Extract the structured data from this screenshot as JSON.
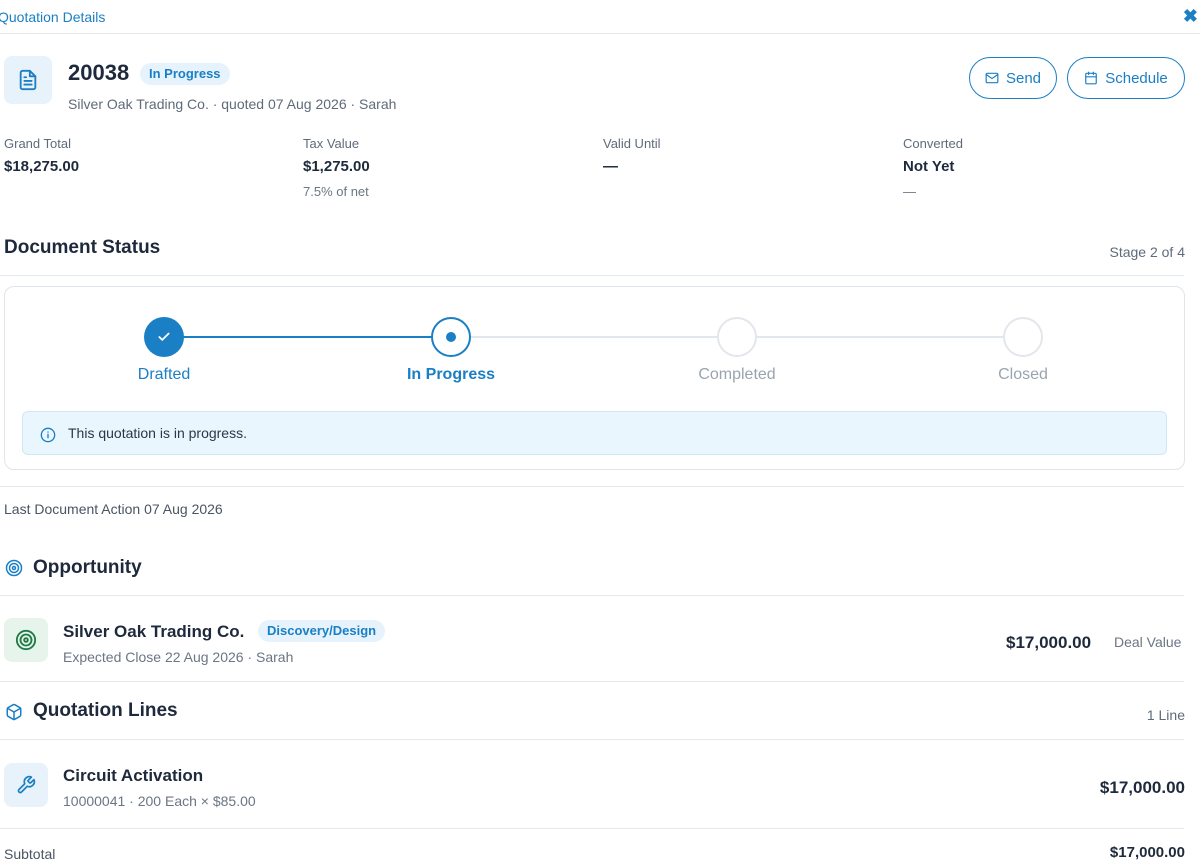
{
  "window": {
    "title": "Quotation Details"
  },
  "quote": {
    "number": "20038",
    "status": "In Progress",
    "customer": "Silver Oak Trading Co.",
    "quoted_text": "quoted 07 Aug 2026",
    "owner": "Sarah",
    "subline": "Silver Oak Trading Co. · quoted 07 Aug 2026 · Sarah"
  },
  "actions": {
    "send_label": "Send",
    "schedule_label": "Schedule"
  },
  "kpis": {
    "grand_total": {
      "label": "Grand Total",
      "value": "$18,275.00"
    },
    "tax_value": {
      "label": "Tax Value",
      "value": "$1,275.00",
      "sub": "7.5% of net"
    },
    "valid_until": {
      "label": "Valid Until",
      "value": "—"
    },
    "converted": {
      "label": "Converted",
      "value": "Not Yet",
      "sub": "—"
    }
  },
  "document_status": {
    "title": "Document Status",
    "stage_text": "Stage 2 of 4",
    "steps": [
      {
        "label": "Drafted",
        "state": "done"
      },
      {
        "label": "In Progress",
        "state": "active"
      },
      {
        "label": "Completed",
        "state": "todo"
      },
      {
        "label": "Closed",
        "state": "todo"
      }
    ],
    "info_message": "This quotation is in progress."
  },
  "last_action": "Last Document Action 07 Aug 2026",
  "opportunity": {
    "section_title": "Opportunity",
    "name": "Silver Oak Trading Co.",
    "stage": "Discovery/Design",
    "detail": "Expected Close 22 Aug 2026 · Sarah",
    "amount": "$17,000.00",
    "amount_label": "Deal Value"
  },
  "quotation_lines": {
    "section_title": "Quotation Lines",
    "count_text": "1 Line",
    "items": [
      {
        "name": "Circuit Activation",
        "detail": "10000041 · 200 Each × $85.00",
        "amount": "$17,000.00"
      }
    ]
  },
  "summary": {
    "subtotal_label": "Subtotal",
    "subtotal_value": "$17,000.00"
  },
  "colors": {
    "accent": "#1a7fc4",
    "text": "#1e2a3b",
    "muted": "#5f6b7a",
    "success_bg": "#e6f4ec"
  },
  "icons": {
    "document": "document-icon",
    "close": "close-icon",
    "send": "mail-icon",
    "schedule": "calendar-icon",
    "check": "check-icon",
    "info": "info-icon",
    "opportunity": "target-icon",
    "lines": "box-icon",
    "line_item": "wrench-icon"
  }
}
